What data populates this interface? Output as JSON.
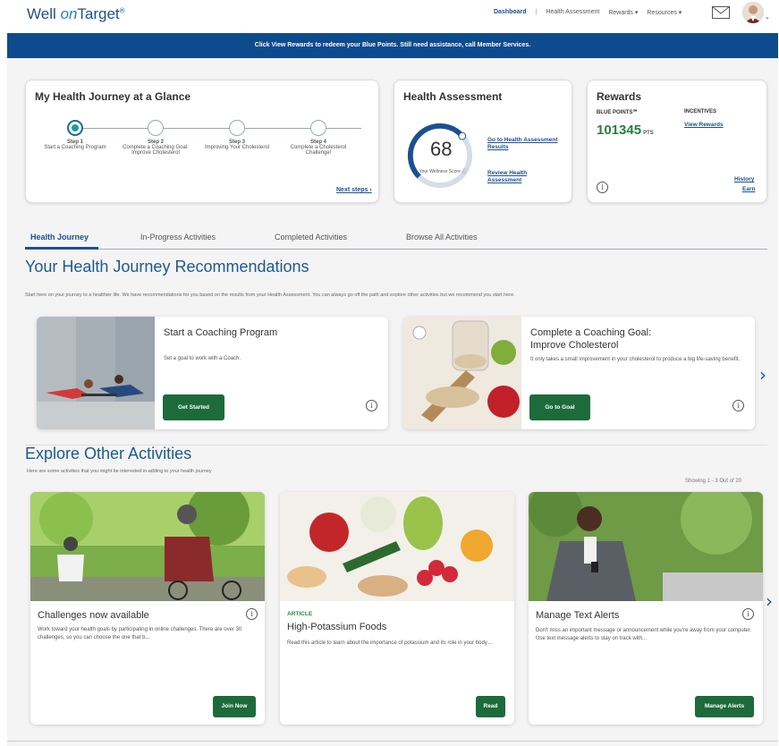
{
  "header": {
    "logo_well": "Well ",
    "logo_on": "on",
    "logo_target": "Target",
    "logo_mark": "®",
    "nav": {
      "dashboard": "Dashboard",
      "health_assessment": "Health Assessment",
      "rewards": "Rewards ▾",
      "resources": "Resources ▾"
    }
  },
  "banner": "Click View Rewards to redeem your Blue Points. Still need assistance, call Member Services.",
  "journey": {
    "title": "My Health Journey at a Glance",
    "steps": [
      {
        "num": "Step 1",
        "label": "Start a Coaching Program"
      },
      {
        "num": "Step 2",
        "label": "Complete a Coaching Goal: Improve Cholesterol"
      },
      {
        "num": "Step 3",
        "label": "Improving Your Cholesterol"
      },
      {
        "num": "Step 4",
        "label": "Complete a Cholesterol Challenge!"
      }
    ],
    "next_steps": "Next steps ›"
  },
  "assessment": {
    "title": "Health Assessment",
    "score": "68",
    "score_max": 100,
    "score_label": "Your Wellness Score ⓘ",
    "link_results": "Go to Health Assessment Results",
    "link_review": "Review Health Assessment"
  },
  "rewards": {
    "title": "Rewards",
    "blue_points_label": "BLUE POINTS℠",
    "points": "101345",
    "pts": "PTS",
    "incentives_label": "INCENTIVES",
    "view_rewards": "View Rewards",
    "history": "History",
    "earn": "Earn"
  },
  "tabs": [
    "Health Journey",
    "In-Progress Activities",
    "Completed Activities",
    "Browse All Activities"
  ],
  "recommendations": {
    "title": "Your Health Journey Recommendations",
    "desc": "Start here on your journey to a healthier life. We have recommendations for you based on the results from your Health Assessment. You can always go off the path and explore other activities but we recommend you start here.",
    "cards": [
      {
        "title": "Start a Coaching Program",
        "desc": "Set a goal to work with a Coach.",
        "button": "Get Started"
      },
      {
        "title": "Complete a Coaching Goal:\nImprove Cholesterol",
        "desc": "It only takes a small improvement in your cholesterol to produce a big life-saving benefit.",
        "button": "Go to Goal"
      }
    ]
  },
  "explore": {
    "title": "Explore Other Activities",
    "desc": "Here are some activities that you might be interested in adding to your health journey",
    "showing": "Showing 1 - 3 Out of 20",
    "cards": [
      {
        "tag": "",
        "title": "Challenges now available",
        "desc": "Work toward your health goals by participating in online challenges. There are over 30 challenges, so you can choose the one that b...",
        "button": "Join Now"
      },
      {
        "tag": "ARTICLE",
        "title": "High-Potassium Foods",
        "desc": "Read this article to learn about the importance of potassium and its role in your body....",
        "button": "Read"
      },
      {
        "tag": "",
        "title": "Manage Text Alerts",
        "desc": "Don't miss an important message or announcement while you're away from your computer. Use text message alerts to stay on track with...",
        "button": "Manage Alerts"
      }
    ]
  },
  "colors": {
    "brand_blue": "#0d4b8c",
    "accent_green": "#1d6b3b",
    "points_green": "#2a7d3c"
  }
}
